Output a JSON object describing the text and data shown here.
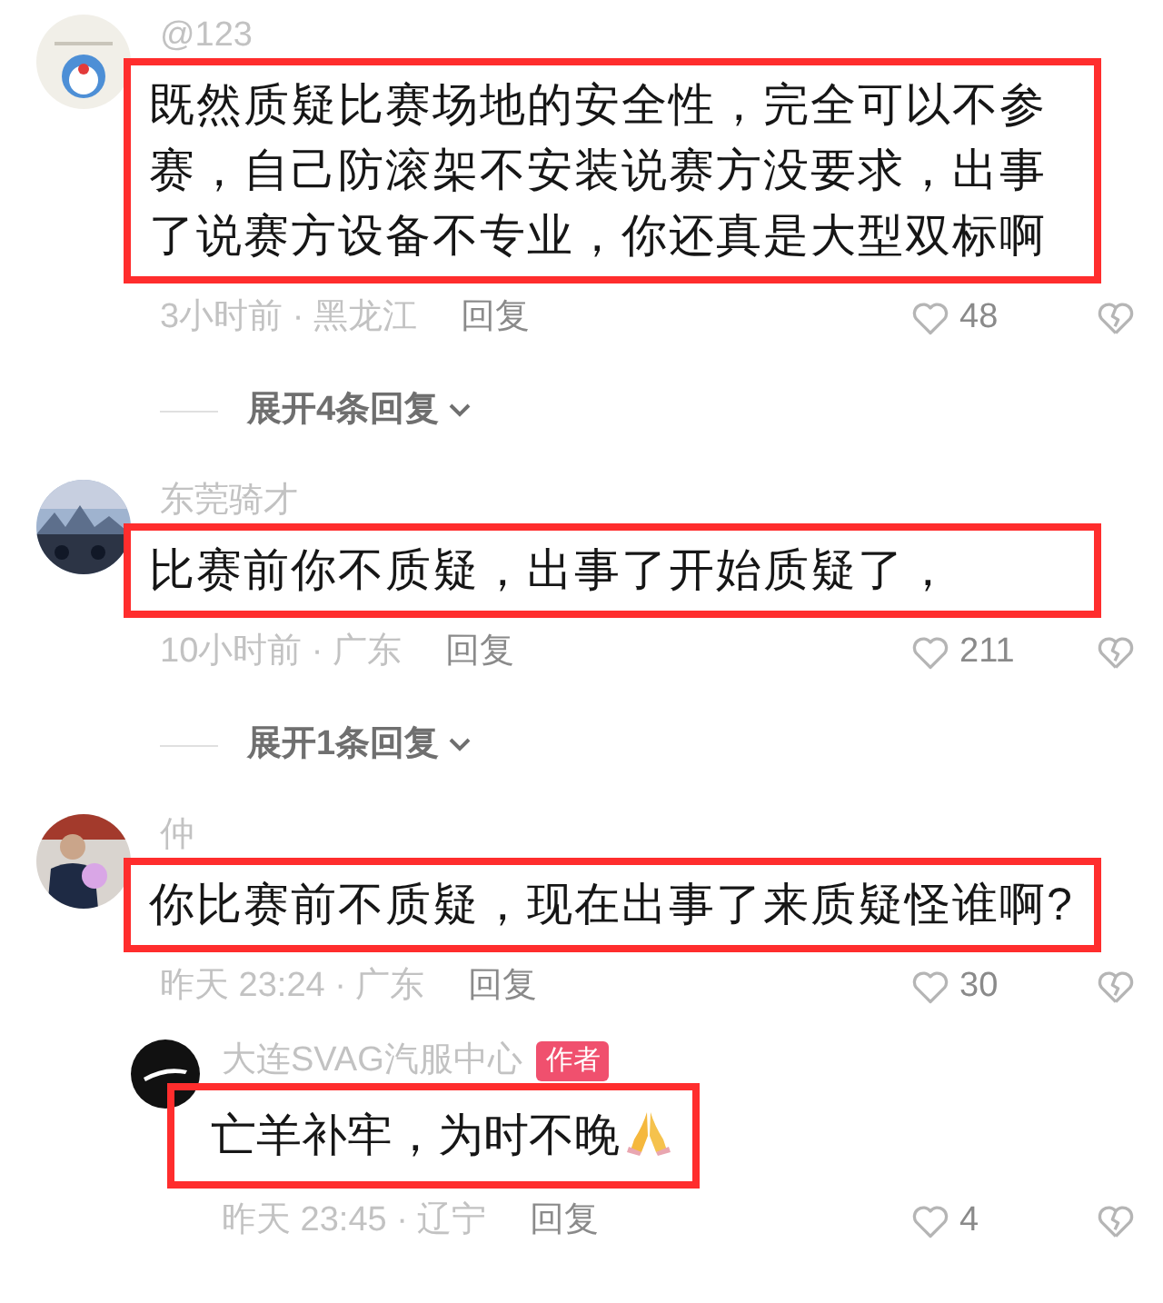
{
  "comments": [
    {
      "name": "@123",
      "avatar": {
        "kind": "cartoon"
      },
      "highlighted": true,
      "text": "既然质疑比赛场地的安全性，完全可以不参赛，自己防滚架不安装说赛方没要求，出事了说赛方设备不专业，你还真是大型双标啊",
      "meta": "3小时前 · 黑龙江",
      "reply_label": "回复",
      "likes": "48",
      "expand": "展开4条回复"
    },
    {
      "name": "东莞骑才",
      "avatar": {
        "kind": "scenery"
      },
      "highlighted": true,
      "text": "比赛前你不质疑，出事了开始质疑了，",
      "meta": "10小时前 · 广东",
      "reply_label": "回复",
      "likes": "211",
      "expand": "展开1条回复"
    },
    {
      "name": "仲",
      "avatar": {
        "kind": "person"
      },
      "highlighted": true,
      "text": "你比赛前不质疑，现在出事了来质疑怪谁啊?",
      "meta": "昨天 23:24 · 广东",
      "reply_label": "回复",
      "likes": "30",
      "replies": [
        {
          "name": "大连SVAG汽服中心",
          "badge": "作者",
          "avatar": {
            "kind": "logo"
          },
          "highlighted": true,
          "text": "亡羊补牢，为时不晚",
          "emoji": {
            "kind": "praying-hands"
          },
          "meta": "昨天 23:45 · 辽宁",
          "reply_label": "回复",
          "likes": "4"
        }
      ]
    }
  ]
}
